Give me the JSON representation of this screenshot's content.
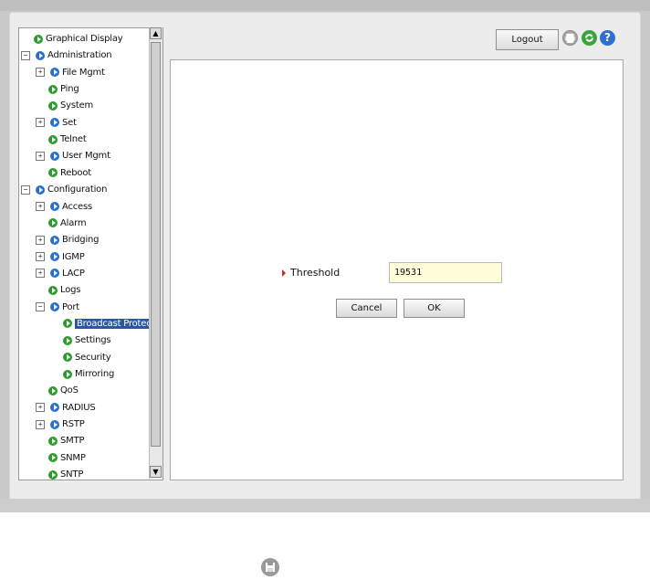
{
  "tree": {
    "items": [
      {
        "label": "Graphical Display",
        "level": 0,
        "icon": "green",
        "expand": ""
      },
      {
        "label": "Administration",
        "level": 0,
        "icon": "blue",
        "expand": "−"
      },
      {
        "label": "File Mgmt",
        "level": 1,
        "icon": "blue",
        "expand": "+"
      },
      {
        "label": "Ping",
        "level": 1,
        "icon": "green",
        "expand": ""
      },
      {
        "label": "System",
        "level": 1,
        "icon": "green",
        "expand": ""
      },
      {
        "label": "Set",
        "level": 1,
        "icon": "blue",
        "expand": "+"
      },
      {
        "label": "Telnet",
        "level": 1,
        "icon": "green",
        "expand": ""
      },
      {
        "label": "User Mgmt",
        "level": 1,
        "icon": "blue",
        "expand": "+"
      },
      {
        "label": "Reboot",
        "level": 1,
        "icon": "green",
        "expand": ""
      },
      {
        "label": "Configuration",
        "level": 0,
        "icon": "blue",
        "expand": "−"
      },
      {
        "label": "Access",
        "level": 1,
        "icon": "blue",
        "expand": "+"
      },
      {
        "label": "Alarm",
        "level": 1,
        "icon": "green",
        "expand": ""
      },
      {
        "label": "Bridging",
        "level": 1,
        "icon": "blue",
        "expand": "+"
      },
      {
        "label": "IGMP",
        "level": 1,
        "icon": "blue",
        "expand": "+"
      },
      {
        "label": "LACP",
        "level": 1,
        "icon": "blue",
        "expand": "+"
      },
      {
        "label": "Logs",
        "level": 1,
        "icon": "green",
        "expand": ""
      },
      {
        "label": "Port",
        "level": 1,
        "icon": "blue",
        "expand": "−"
      },
      {
        "label": "Broadcast Protect",
        "level": 2,
        "icon": "green",
        "expand": "",
        "selected": true
      },
      {
        "label": "Settings",
        "level": 2,
        "icon": "green",
        "expand": ""
      },
      {
        "label": "Security",
        "level": 2,
        "icon": "green",
        "expand": ""
      },
      {
        "label": "Mirroring",
        "level": 2,
        "icon": "green",
        "expand": ""
      },
      {
        "label": "QoS",
        "level": 1,
        "icon": "green",
        "expand": ""
      },
      {
        "label": "RADIUS",
        "level": 1,
        "icon": "blue",
        "expand": "+"
      },
      {
        "label": "RSTP",
        "level": 1,
        "icon": "blue",
        "expand": "+"
      },
      {
        "label": "SMTP",
        "level": 1,
        "icon": "green",
        "expand": ""
      },
      {
        "label": "SNMP",
        "level": 1,
        "icon": "green",
        "expand": ""
      },
      {
        "label": "SNTP",
        "level": 1,
        "icon": "green",
        "expand": ""
      }
    ]
  },
  "toolbar": {
    "logout_label": "Logout",
    "icons": [
      "print-icon",
      "refresh-icon",
      "help-icon"
    ]
  },
  "form": {
    "threshold_label": "Threshold",
    "threshold_value": "19531",
    "cancel_label": "Cancel",
    "ok_label": "OK"
  },
  "colors": {
    "selected_bg": "#2b56a3",
    "input_bg": "#fffcd9",
    "refresh_icon": "#3aa53a",
    "help_icon": "#2f6fd0",
    "print_icon": "#9a9a9a"
  }
}
